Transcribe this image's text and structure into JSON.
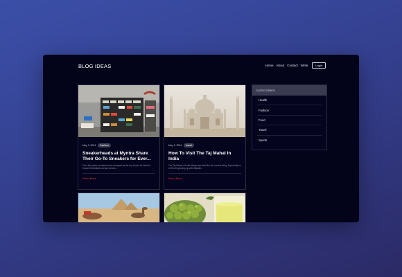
{
  "header": {
    "brand": "BLOG IDEAS",
    "nav": [
      "Home",
      "About",
      "Contact",
      "Write"
    ],
    "login_label": "Login"
  },
  "posts": [
    {
      "date": "May 3, 2024",
      "category": "Fashion",
      "title": "Sneakerheads at Myntra Share Their Go-To Sneakers for Ever...",
      "excerpt": "Over the years, sneakers have emerged as the top choice for fashion-forward individuals across various...",
      "read_more": "Read More"
    },
    {
      "date": "May 3, 2024",
      "category": "travel",
      "title": "How To Visit The Taj Mahal In India",
      "excerpt": "The Taj Mahal of India always seemed like the coolest thing. Especially as a 90s kid growing up with Aladdin...",
      "read_more": "Read More"
    },
    {
      "image": "desert-camels"
    },
    {
      "image": "olives-and-juice"
    }
  ],
  "sidebar": {
    "title": "CATEGORIES",
    "items": [
      "Health",
      "Fashion",
      "Food",
      "Travel",
      "Sports"
    ]
  },
  "colors": {
    "accent_red": "#d73a2f",
    "window_bg": "#03031a",
    "badge_bg": "#3d3d52"
  }
}
